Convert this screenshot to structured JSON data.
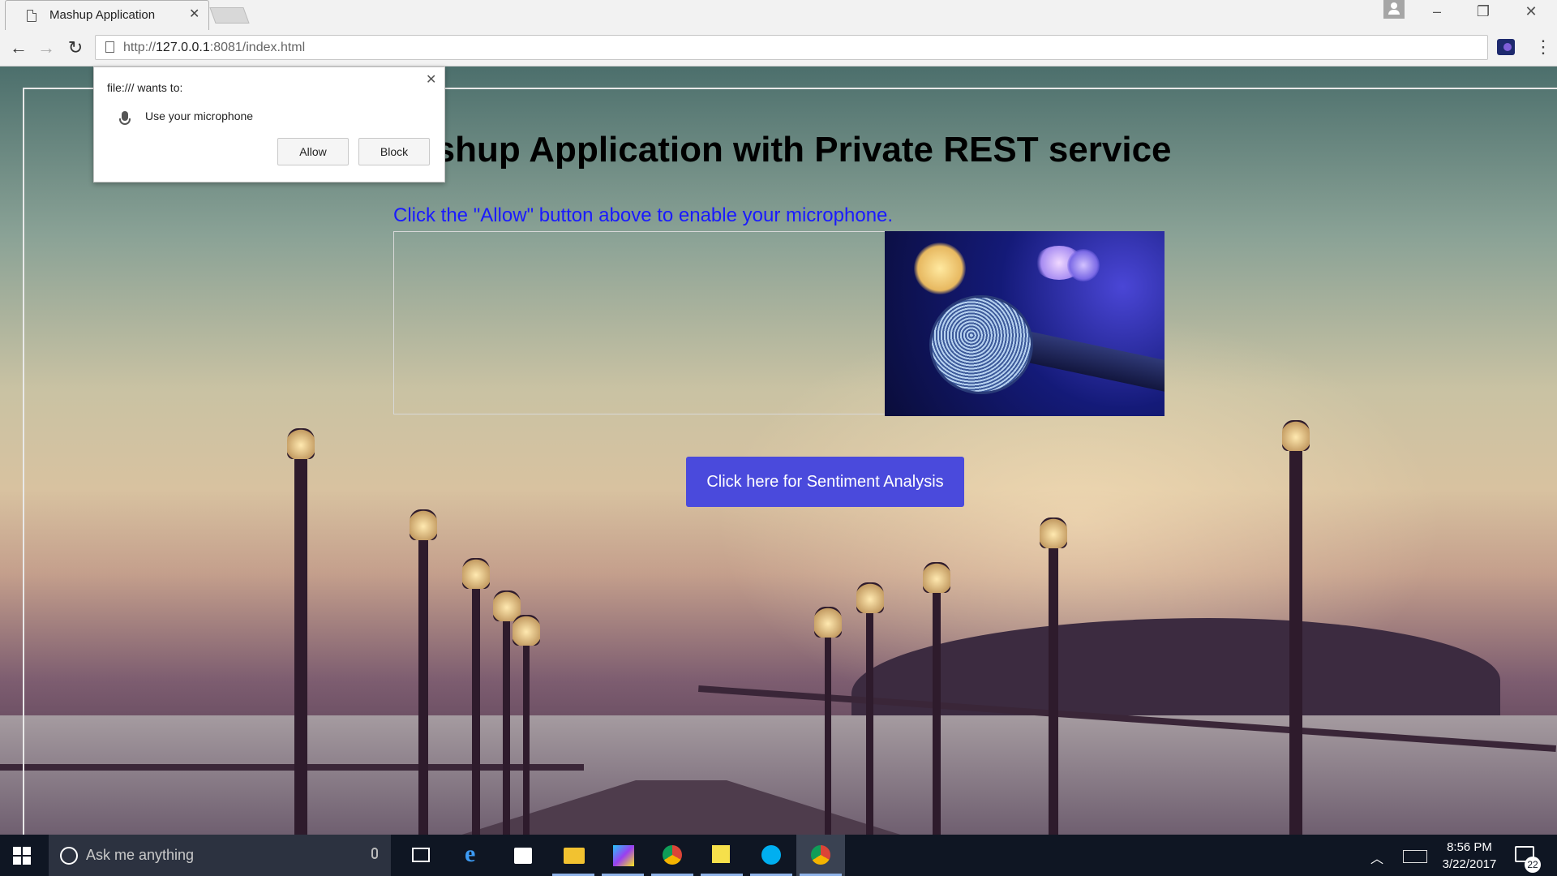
{
  "browser": {
    "tab_title": "Mashup Application",
    "url_prefix": "http://",
    "url_host": "127.0.0.1",
    "url_rest": ":8081/index.html"
  },
  "page": {
    "heading": "Mashup Application with Private REST service",
    "instruction": "Click the \"Allow\" button above to enable your microphone.",
    "sentiment_button": "Click here for Sentiment Analysis"
  },
  "permission_popup": {
    "title": "file:/// wants to:",
    "permission": "Use your microphone",
    "allow_label": "Allow",
    "block_label": "Block"
  },
  "taskbar": {
    "search_placeholder": "Ask me anything",
    "time": "8:56 PM",
    "date": "3/22/2017",
    "notification_count": "22",
    "apps": [
      "task-view-icon",
      "edge-icon",
      "store-icon",
      "file-explorer-icon",
      "webstorm-icon",
      "chrome-icon",
      "sticky-notes-icon",
      "skype-icon",
      "chrome-icon"
    ]
  },
  "colors": {
    "instruction_text": "#1a1aff",
    "button_bg": "#4a4adc",
    "taskbar_bg": "#0f1623"
  }
}
